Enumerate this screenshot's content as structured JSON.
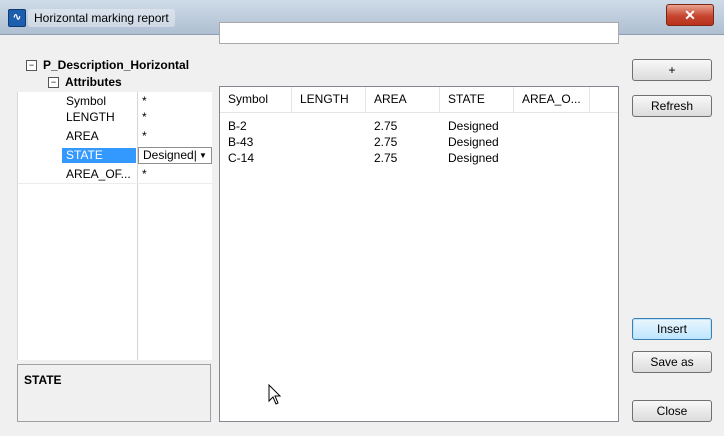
{
  "window": {
    "title": "Horizontal marking report",
    "app_icon": "chart-app-icon",
    "close_label": "✕"
  },
  "tree": {
    "root_label": "P_Description_Horizontal",
    "root_toggle": "−",
    "group_label": "Attributes",
    "group_toggle": "−"
  },
  "properties": [
    {
      "name": "Symbol",
      "value": "*"
    },
    {
      "name": "LENGTH",
      "value": "*"
    },
    {
      "name": "AREA",
      "value": "*"
    },
    {
      "name": "STATE",
      "value": "Designed|",
      "selected": true,
      "dropdown": "▼"
    },
    {
      "name": "AREA_OF...",
      "value": "*"
    }
  ],
  "description": {
    "title": "STATE"
  },
  "filter": {
    "value": ""
  },
  "list": {
    "columns": [
      "Symbol",
      "LENGTH",
      "AREA",
      "STATE",
      "AREA_O..."
    ],
    "rows": [
      [
        "B-2",
        "",
        "2.75",
        "Designed",
        ""
      ],
      [
        "B-43",
        "",
        "2.75",
        "Designed",
        ""
      ],
      [
        "C-14",
        "",
        "2.75",
        "Designed",
        ""
      ]
    ]
  },
  "buttons": {
    "add": "+",
    "refresh": "Refresh",
    "insert": "Insert",
    "save_as": "Save as",
    "close": "Close"
  },
  "colors": {
    "selection": "#3399ff",
    "close_button": "#c64530"
  }
}
